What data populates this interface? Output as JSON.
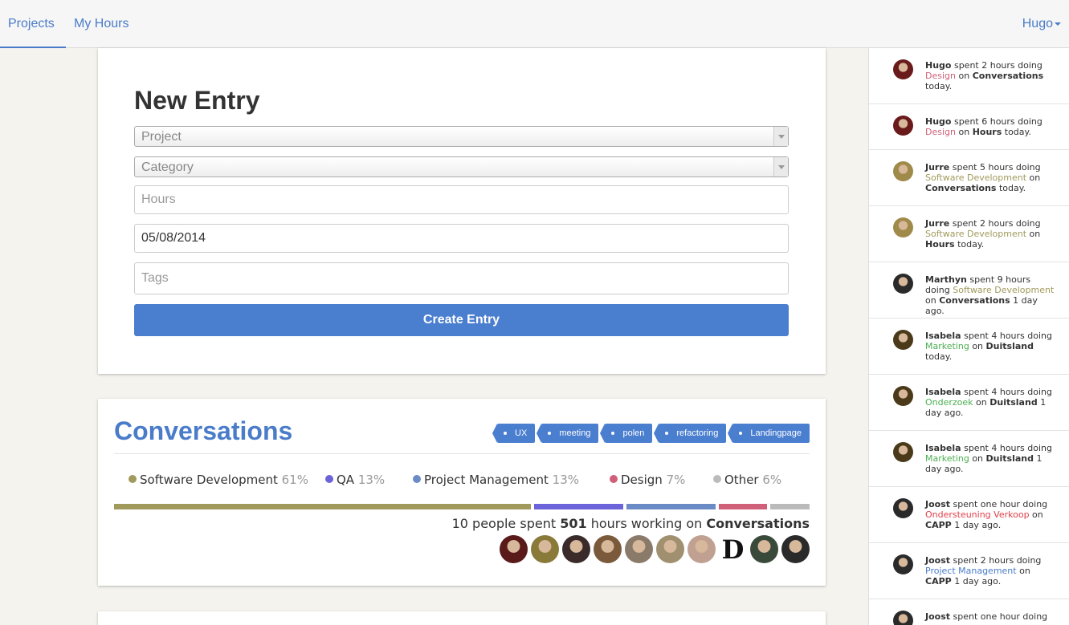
{
  "nav": {
    "projects_label": "Projects",
    "my_hours_label": "My Hours",
    "user_label": "Hugo"
  },
  "form": {
    "title": "New Entry",
    "project_placeholder": "Project",
    "category_placeholder": "Category",
    "hours_placeholder": "Hours",
    "date_value": "05/08/2014",
    "tags_placeholder": "Tags",
    "submit_label": "Create Entry"
  },
  "project": {
    "title": "Conversations",
    "tags": [
      "UX",
      "meeting",
      "polen",
      "refactoring",
      "Landingpage"
    ],
    "categories": [
      {
        "name": "Software Development",
        "percent": "61%",
        "share": 61,
        "color": "#a09a5c"
      },
      {
        "name": "QA",
        "percent": "13%",
        "share": 13,
        "color": "#6b63d9"
      },
      {
        "name": "Project Management",
        "percent": "13%",
        "share": 13,
        "color": "#6a8bc6"
      },
      {
        "name": "Design",
        "percent": "7%",
        "share": 7,
        "color": "#d0607a"
      },
      {
        "name": "Other",
        "percent": "6%",
        "share": 6,
        "color": "#bbbbbb"
      }
    ],
    "summary": {
      "prefix": "10 people spent",
      "hours": "501",
      "middle": "hours working on",
      "project": "Conversations"
    },
    "contributors": [
      {
        "initial": "",
        "color": "#5a1a1a"
      },
      {
        "initial": "",
        "color": "#8a7a3a"
      },
      {
        "initial": "",
        "color": "#3a2a2a"
      },
      {
        "initial": "",
        "color": "#7a5a3a"
      },
      {
        "initial": "",
        "color": "#8a7a6a"
      },
      {
        "initial": "",
        "color": "#a09070"
      },
      {
        "initial": "",
        "color": "#c0a090"
      },
      {
        "initial": "D",
        "color": "#ffffff"
      },
      {
        "initial": "",
        "color": "#3a4a3a"
      },
      {
        "initial": "",
        "color": "#2a2a2a"
      }
    ]
  },
  "feed": [
    {
      "user": "Hugo",
      "pre": "spent 2 hours doing",
      "category": "Design",
      "cat_color": "#d0607a",
      "on": "on",
      "project": "Conversations",
      "when": "today.",
      "avatar_color": "#6a1a1a"
    },
    {
      "user": "Hugo",
      "pre": "spent 6 hours doing",
      "category": "Design",
      "cat_color": "#d0607a",
      "on": "on",
      "project": "Hours",
      "when": "today.",
      "avatar_color": "#6a1a1a"
    },
    {
      "user": "Jurre",
      "pre": "spent 5 hours doing",
      "category": "Software Development",
      "cat_color": "#a09a5c",
      "on": "on",
      "project": "Conversations",
      "when": "today.",
      "avatar_color": "#a08a4a"
    },
    {
      "user": "Jurre",
      "pre": "spent 2 hours doing",
      "category": "Software Development",
      "cat_color": "#a09a5c",
      "on": "on",
      "project": "Hours",
      "when": "today.",
      "avatar_color": "#a08a4a"
    },
    {
      "user": "Marthyn",
      "pre": "spent 9 hours doing",
      "category": "Software Development",
      "cat_color": "#a09a5c",
      "on": "on",
      "project": "Conversations",
      "when": "1 day ago.",
      "avatar_color": "#2a2a2a"
    },
    {
      "user": "Isabela",
      "pre": "spent 4 hours doing",
      "category": "Marketing",
      "cat_color": "#4caf50",
      "on": "on",
      "project": "Duitsland",
      "when": "today.",
      "avatar_color": "#4a3a1a"
    },
    {
      "user": "Isabela",
      "pre": "spent 4 hours doing",
      "category": "Onderzoek",
      "cat_color": "#4caf50",
      "on": "on",
      "project": "Duitsland",
      "when": "1 day ago.",
      "avatar_color": "#4a3a1a"
    },
    {
      "user": "Isabela",
      "pre": "spent 4 hours doing",
      "category": "Marketing",
      "cat_color": "#4caf50",
      "on": "on",
      "project": "Duitsland",
      "when": "1 day ago.",
      "avatar_color": "#4a3a1a"
    },
    {
      "user": "Joost",
      "pre": "spent one hour doing",
      "category": "Ondersteuning Verkoop",
      "cat_color": "#e0404a",
      "on": "on",
      "project": "CAPP",
      "when": "1 day ago.",
      "avatar_color": "#2a2a2a"
    },
    {
      "user": "Joost",
      "pre": "spent 2 hours doing",
      "category": "Project Management",
      "cat_color": "#4a7cc9",
      "on": "on",
      "project": "CAPP",
      "when": "1 day ago.",
      "avatar_color": "#2a2a2a"
    },
    {
      "user": "Joost",
      "pre": "spent one hour doing",
      "category": "",
      "cat_color": "#333333",
      "on": "",
      "project": "",
      "when": "",
      "avatar_color": "#2a2a2a"
    }
  ]
}
